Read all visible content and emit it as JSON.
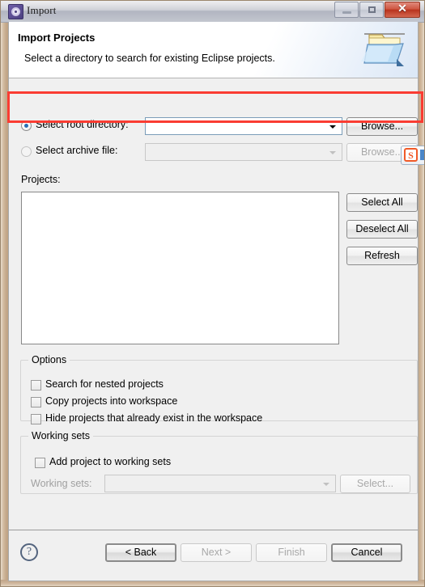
{
  "window": {
    "title": "Import",
    "icon": "eclipse-wizard-icon",
    "controls": {
      "minimize": "minimize-icon",
      "maximize": "maximize-icon",
      "close": "✕"
    }
  },
  "header": {
    "title": "Import Projects",
    "description": "Select a directory to search for existing Eclipse projects.",
    "banner_icon": "open-folder-icon"
  },
  "source": {
    "root_directory": {
      "label": "Select root directory:",
      "selected": true,
      "value": "",
      "browse_label": "Browse...",
      "enabled": true
    },
    "archive_file": {
      "label": "Select archive file:",
      "selected": false,
      "value": "",
      "browse_label": "Browse...",
      "enabled": false
    }
  },
  "projects": {
    "label": "Projects:",
    "items": [],
    "buttons": [
      {
        "label": "Select All",
        "enabled": true
      },
      {
        "label": "Deselect All",
        "enabled": true
      },
      {
        "label": "Refresh",
        "enabled": true
      }
    ]
  },
  "options": {
    "title": "Options",
    "checkboxes": [
      {
        "label": "Search for nested projects",
        "checked": false
      },
      {
        "label": "Copy projects into workspace",
        "checked": false
      },
      {
        "label": "Hide projects that already exist in the workspace",
        "checked": false
      }
    ]
  },
  "working_sets": {
    "title": "Working sets",
    "add_checkbox": {
      "label": "Add project to working sets",
      "checked": false
    },
    "combo_label": "Working sets:",
    "combo_value": "",
    "select_label": "Select...",
    "enabled": false
  },
  "footer": {
    "help_glyph": "?",
    "buttons": [
      {
        "label": "< Back",
        "enabled": true,
        "default": true
      },
      {
        "label": "Next >",
        "enabled": false,
        "default": false
      },
      {
        "label": "Finish",
        "enabled": false,
        "default": false
      },
      {
        "label": "Cancel",
        "enabled": true,
        "default": true
      }
    ]
  },
  "annotation": {
    "color": "#fa3c32",
    "target": "select-root-directory-row"
  },
  "ime": {
    "name": "sogou-input-method-bar",
    "logo_glyph": "S"
  }
}
